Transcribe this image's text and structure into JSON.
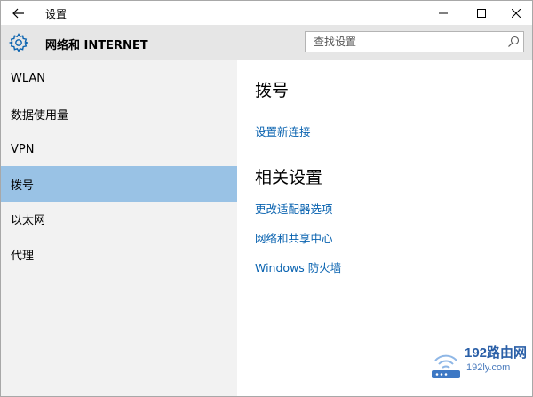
{
  "window": {
    "title": "设置"
  },
  "header": {
    "title": "网络和 INTERNET",
    "search_placeholder": "查找设置"
  },
  "sidebar": {
    "items": [
      {
        "label": "WLAN",
        "active": false
      },
      {
        "label": "数据使用量",
        "active": false
      },
      {
        "label": "VPN",
        "active": false
      },
      {
        "label": "拨号",
        "active": true
      },
      {
        "label": "以太网",
        "active": false
      },
      {
        "label": "代理",
        "active": false
      }
    ]
  },
  "main": {
    "section1_title": "拨号",
    "new_connection_link": "设置新连接",
    "section2_title": "相关设置",
    "related_links": [
      "更改适配器选项",
      "网络和共享中心",
      "Windows 防火墙"
    ]
  },
  "watermark": {
    "brand": "192路由网",
    "domain": "192ly.com"
  },
  "colors": {
    "accent_link": "#0a63b0",
    "active_item": "#99c2e5",
    "header_bg": "#e6e6e6",
    "sidebar_bg": "#f2f2f2"
  }
}
